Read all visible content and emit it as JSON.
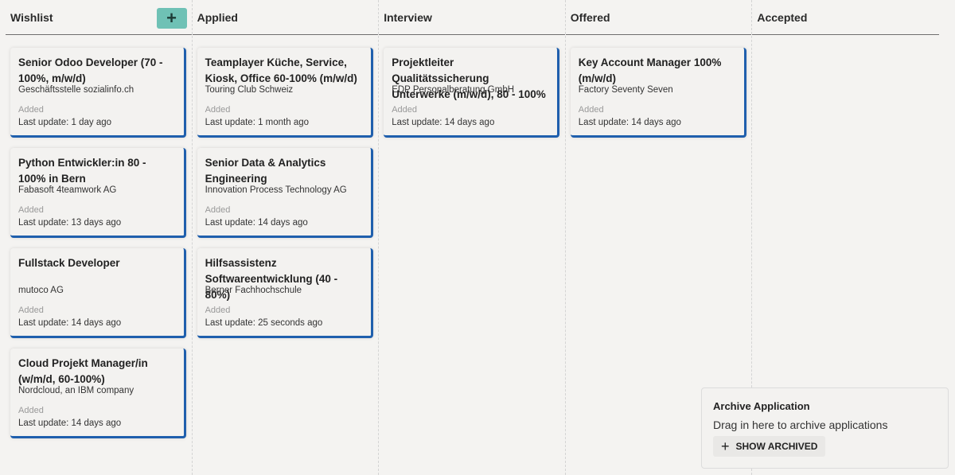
{
  "columns": [
    {
      "title": "Wishlist",
      "cards": [
        {
          "title": "Senior Odoo Developer (70 - 100%, m/w/d)",
          "company": "Geschäftsstelle sozialinfo.ch",
          "status": "Added",
          "updated": "Last update: 1 day ago"
        },
        {
          "title": "Python Entwickler:in 80 - 100% in Bern",
          "company": "Fabasoft 4teamwork AG",
          "status": "Added",
          "updated": "Last update: 13 days ago"
        },
        {
          "title": "Fullstack Developer",
          "company": "mutoco AG",
          "status": "Added",
          "updated": "Last update: 14 days ago"
        },
        {
          "title": "Cloud Projekt Manager/in (w/m/d, 60-100%)",
          "company": "Nordcloud, an IBM company",
          "status": "Added",
          "updated": "Last update: 14 days ago"
        }
      ]
    },
    {
      "title": "Applied",
      "cards": [
        {
          "title": "Teamplayer Küche, Service, Ki­osk, Office 60-100% (m/w/d)",
          "company": "Touring Club Schweiz",
          "status": "Added",
          "updated": "Last update: 1 month ago"
        },
        {
          "title": "Senior Data & Analytics Enginee­ring",
          "company": "Innovation Process Technology AG",
          "status": "Added",
          "updated": "Last update: 14 days ago"
        },
        {
          "title": "Hilfsassistenz Softwareentwick­lung (40 - 80%)",
          "company": "Berner Fachhochschule",
          "status": "Added",
          "updated": "Last update: 25 seconds ago"
        }
      ]
    },
    {
      "title": "Interview",
      "cards": [
        {
          "title": "Projektleiter Qualitätssicherung Unterwerke (m/w/d), 80 - 100%",
          "company": "EDP Personalberatung GmbH",
          "status": "Added",
          "updated": "Last update: 14 days ago"
        }
      ]
    },
    {
      "title": "Offered",
      "cards": [
        {
          "title": "Key Account Manager 100% (m/w/d)",
          "company": "Factory Seventy Seven",
          "status": "Added",
          "updated": "Last update: 14 days ago"
        }
      ]
    },
    {
      "title": "Accepted",
      "cards": []
    }
  ],
  "add_button": {
    "icon": "plus-icon",
    "label": "+"
  },
  "archive": {
    "title": "Archive Application",
    "hint": "Drag in here to archive applications",
    "button_label": "SHOW ARCHIVED",
    "button_icon": "plus-icon"
  },
  "colors": {
    "accent": "#6fc1b5",
    "card_border": "#1f5fad"
  }
}
